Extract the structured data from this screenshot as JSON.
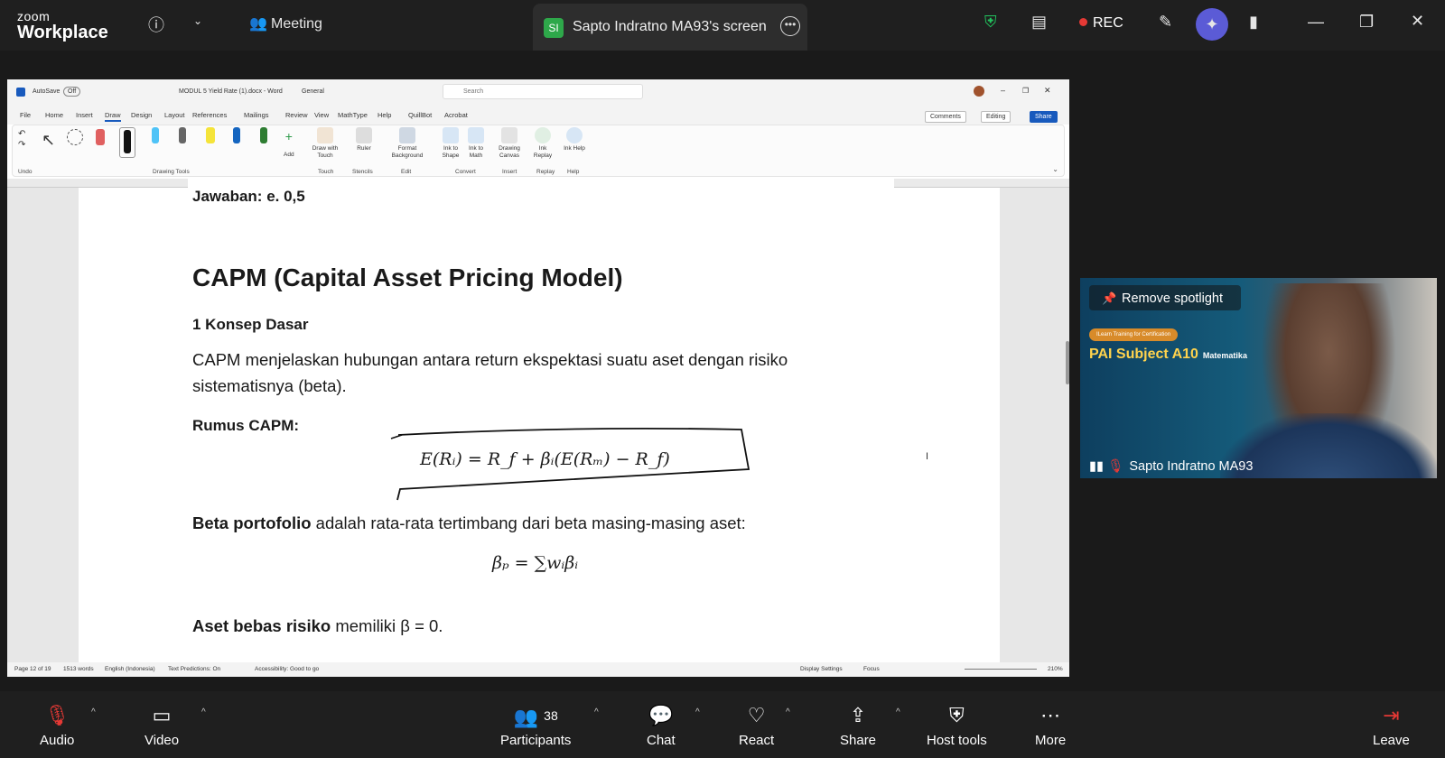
{
  "zoom": {
    "brand_top": "zoom",
    "brand_bottom": "Workplace",
    "meeting_label": "Meeting",
    "share_tab": {
      "initials": "SI",
      "title": "Sapto Indratno MA93's screen"
    },
    "rec_label": "REC"
  },
  "word": {
    "titlebar": {
      "autosave": "AutoSave",
      "autosave_state": "Off",
      "doc_name": "MODUL 5 Yield Rate (1).docx - Word",
      "sensitivity": "General",
      "search_placeholder": "Search"
    },
    "menu": [
      "File",
      "Home",
      "Insert",
      "Draw",
      "Design",
      "Layout",
      "References",
      "Mailings",
      "Review",
      "View",
      "MathType",
      "Help",
      "QuillBot",
      "Acrobat"
    ],
    "menu_active": "Draw",
    "menu_buttons": {
      "comments": "Comments",
      "editing": "Editing",
      "share": "Share"
    },
    "ribbon_groups": {
      "undo": "Undo",
      "drawing_tools": "Drawing Tools",
      "touch": "Touch",
      "stencils": "Stencils",
      "edit": "Edit",
      "convert": "Convert",
      "insert": "Insert",
      "replay": "Replay",
      "help": "Help"
    },
    "ribbon_buttons": {
      "add": "Add",
      "draw_touch": "Draw with Touch",
      "ruler": "Ruler",
      "format_bg": "Format Background",
      "ink_shape": "Ink to Shape",
      "ink_math": "Ink to Math",
      "drawing_canvas": "Drawing Canvas",
      "ink_replay": "Ink Replay",
      "ink_help": "Ink Help"
    },
    "document": {
      "answer": "Jawaban: e. 0,5",
      "heading": "CAPM (Capital Asset Pricing Model)",
      "subheading": "1 Konsep Dasar",
      "paragraph_line1": "CAPM menjelaskan hubungan antara return ekspektasi suatu aset dengan risiko",
      "paragraph_line2": "sistematisnya (beta).",
      "formula_label": "Rumus CAPM:",
      "capm_formula": "E(Rᵢ) = R_f + βᵢ(E(Rₘ) − R_f)",
      "beta_bold": "Beta portofolio",
      "beta_rest": " adalah rata-rata tertimbang dari beta masing-masing aset:",
      "beta_formula": "βₚ = ∑wᵢβᵢ",
      "riskfree_bold": "Aset bebas risiko",
      "riskfree_rest": " memiliki β = 0."
    },
    "status": {
      "page": "Page 12 of 19",
      "words": "1513 words",
      "language": "English (Indonesia)",
      "predictions": "Text Predictions: On",
      "accessibility": "Accessibility: Good to go",
      "display": "Display Settings",
      "focus": "Focus",
      "zoom": "210%"
    }
  },
  "video": {
    "remove_spotlight": "Remove spotlight",
    "badge": "ILearn Training for Certification",
    "title": "PAI Subject A10",
    "title_sub": "Matematika",
    "name": "Sapto Indratno MA93"
  },
  "toolbar": {
    "audio": "Audio",
    "video": "Video",
    "participants": "Participants",
    "participants_count": "38",
    "chat": "Chat",
    "react": "React",
    "share": "Share",
    "host_tools": "Host tools",
    "more": "More",
    "leave": "Leave"
  }
}
